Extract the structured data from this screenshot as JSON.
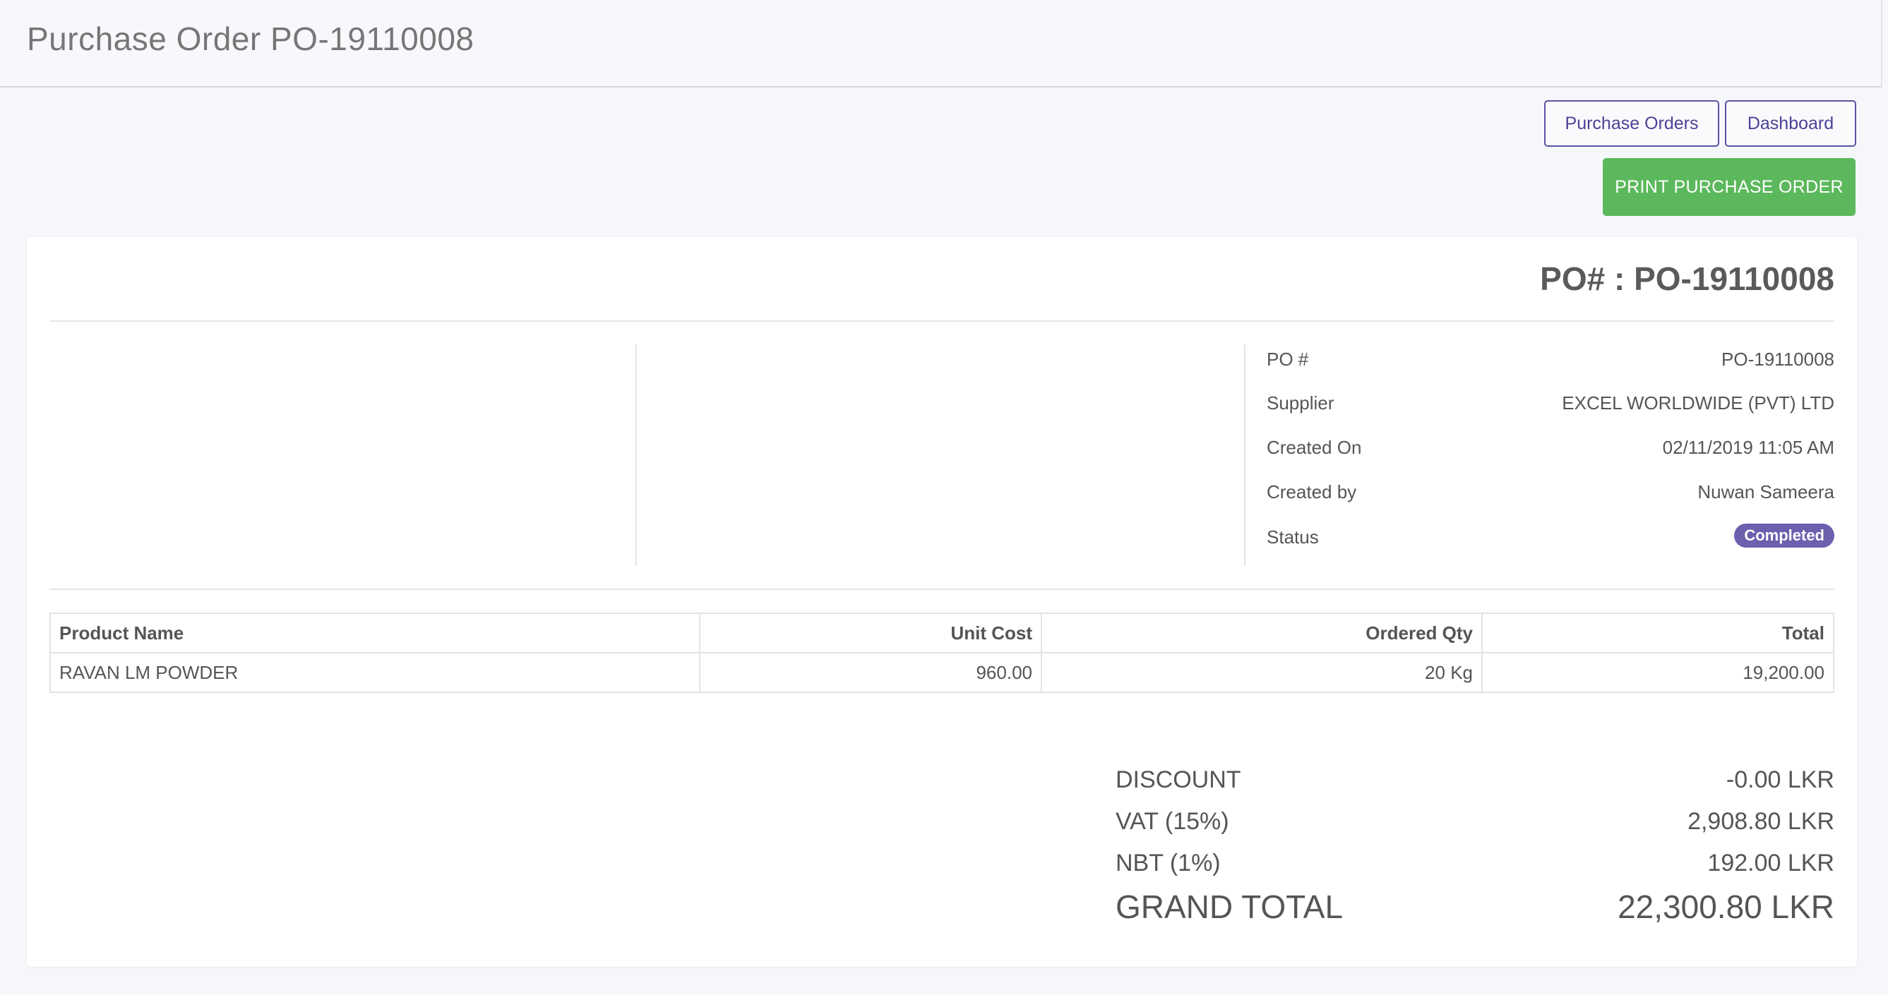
{
  "header": {
    "title": "Purchase Order PO-19110008"
  },
  "toolbar": {
    "purchase_orders_label": "Purchase Orders",
    "dashboard_label": "Dashboard",
    "print_label": "PRINT PURCHASE ORDER"
  },
  "po": {
    "heading": "PO# : PO-19110008",
    "info": [
      {
        "label": "PO #",
        "value": "PO-19110008"
      },
      {
        "label": "Supplier",
        "value": "EXCEL WORLDWIDE (PVT) LTD"
      },
      {
        "label": "Created On",
        "value": "02/11/2019 11:05 AM"
      },
      {
        "label": "Created by",
        "value": "Nuwan Sameera"
      },
      {
        "label": "Status",
        "value": "Completed"
      }
    ]
  },
  "table": {
    "headers": [
      "Product Name",
      "Unit Cost",
      "Ordered Qty",
      "Total"
    ],
    "rows": [
      [
        "RAVAN LM POWDER",
        "960.00",
        "20 Kg",
        "19,200.00"
      ]
    ]
  },
  "totals": {
    "discount_label": "DISCOUNT",
    "discount_value": "-0.00 LKR",
    "vat_label": "VAT (15%)",
    "vat_value": "2,908.80 LKR",
    "nbt_label": "NBT (1%)",
    "nbt_value": "192.00 LKR",
    "grand_label": "GRAND TOTAL",
    "grand_value": "22,300.80 LKR"
  },
  "colors": {
    "accent": "#5b52a5",
    "success": "#5cb85c",
    "badge": "#6c5fae"
  }
}
